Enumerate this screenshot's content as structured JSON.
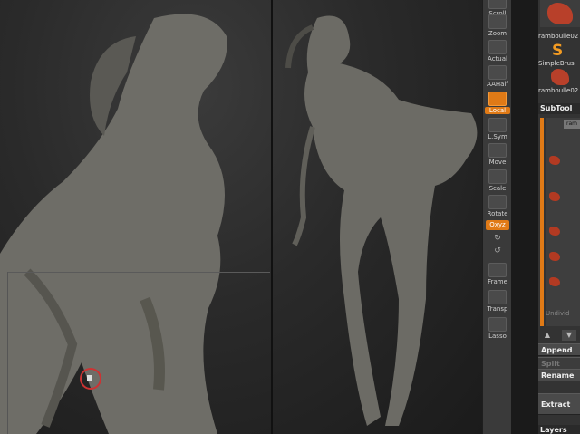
{
  "shelf": {
    "tools": [
      {
        "name": "scroll",
        "label": "Scroll",
        "icon": "scroll-icon"
      },
      {
        "name": "zoom",
        "label": "Zoom",
        "icon": "zoom-icon"
      },
      {
        "name": "actual",
        "label": "Actual",
        "icon": "actual-icon"
      },
      {
        "name": "aahalf",
        "label": "AAHalf",
        "icon": "aahalf-icon"
      },
      {
        "name": "local",
        "label": "Local",
        "icon": "local-icon",
        "active": true
      },
      {
        "name": "lsym",
        "label": "L.Sym",
        "icon": "lsym-icon"
      },
      {
        "name": "move",
        "label": "Move",
        "icon": "move-icon"
      },
      {
        "name": "scale",
        "label": "Scale",
        "icon": "scale-icon"
      },
      {
        "name": "rotate",
        "label": "Rotate",
        "icon": "rotate-icon"
      },
      {
        "name": "frame",
        "label": "Frame",
        "icon": "frame-icon"
      },
      {
        "name": "transp",
        "label": "Transp",
        "icon": "transp-icon"
      },
      {
        "name": "lasso",
        "label": "Lasso",
        "icon": "lasso-icon"
      }
    ],
    "xyz_label": "Qxyz"
  },
  "panel": {
    "thumb1_label": "ramboulle02",
    "brush_label": "SimpleBrus",
    "thumb2_label": "ramboulle02",
    "subtool_header": "SubTool",
    "subtool_selected": "ram",
    "undivided": "Undivid",
    "append": "Append",
    "split": "Split",
    "rename": "Rename",
    "extract": "Extract",
    "layers": "Layers"
  },
  "colors": {
    "accent": "#e07a16",
    "subtool_red": "#b23a22"
  }
}
